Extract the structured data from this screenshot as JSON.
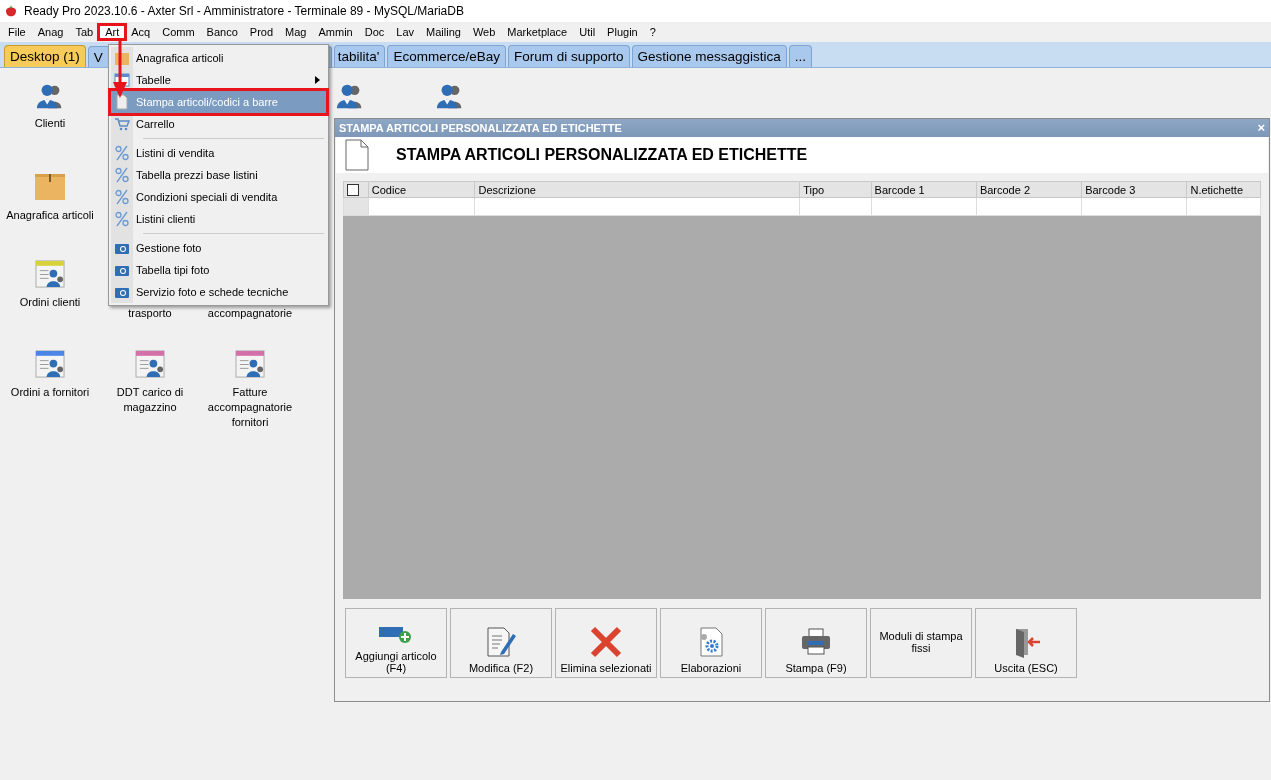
{
  "window": {
    "title": "Ready Pro 2023.10.6 - Axter Srl - Amministratore - Terminale 89 - MySQL/MariaDB"
  },
  "menu_bar": [
    {
      "label": "File",
      "selected": false
    },
    {
      "label": "Anag",
      "selected": false
    },
    {
      "label": "Tab",
      "selected": false
    },
    {
      "label": "Art",
      "selected": true
    },
    {
      "label": "Acq",
      "selected": false
    },
    {
      "label": "Comm",
      "selected": false
    },
    {
      "label": "Banco",
      "selected": false
    },
    {
      "label": "Prod",
      "selected": false
    },
    {
      "label": "Mag",
      "selected": false
    },
    {
      "label": "Ammin",
      "selected": false
    },
    {
      "label": "Doc",
      "selected": false
    },
    {
      "label": "Lav",
      "selected": false
    },
    {
      "label": "Mailing",
      "selected": false
    },
    {
      "label": "Web",
      "selected": false
    },
    {
      "label": "Marketplace",
      "selected": false
    },
    {
      "label": "Util",
      "selected": false
    },
    {
      "label": "Plugin",
      "selected": false
    },
    {
      "label": "?",
      "selected": false
    }
  ],
  "tabs": [
    {
      "label": "Desktop (1)",
      "selected": true
    },
    {
      "label": "V",
      "selected": false
    },
    {
      "label": "tabilita'",
      "selected": false
    },
    {
      "label": "Ecommerce/eBay",
      "selected": false
    },
    {
      "label": "Forum di supporto",
      "selected": false
    },
    {
      "label": "Gestione messaggistica",
      "selected": false
    },
    {
      "label": "...",
      "selected": false
    }
  ],
  "desktop": [
    [
      {
        "kind": "person",
        "label": "Clienti"
      },
      {
        "kind": "covered"
      },
      {
        "kind": "covered"
      },
      {
        "kind": "agent"
      },
      {
        "kind": "agent"
      }
    ],
    [
      {
        "kind": "box",
        "label": "Anagrafica articoli"
      }
    ],
    [
      {
        "kind": "order",
        "color": "#d8d23a",
        "label": "Ordini clienti"
      },
      {
        "kind": "text",
        "label": "trasporto"
      },
      {
        "kind": "text",
        "label": "accompagnatorie"
      }
    ],
    [
      {
        "kind": "order",
        "color": "#4a86e8",
        "label": "Ordini a fornitori"
      },
      {
        "kind": "order",
        "color": "#d46fa8",
        "label": "DDT carico di magazzino"
      },
      {
        "kind": "order",
        "color": "#d46fa8",
        "label": "Fatture accompagnatorie fornitori"
      }
    ]
  ],
  "dropdown": [
    {
      "kind": "box",
      "label": "Anagrafica articoli",
      "selected": false,
      "submenu": false
    },
    {
      "kind": "table",
      "label": "Tabelle",
      "selected": false,
      "submenu": true
    },
    {
      "kind": "page",
      "label": "Stampa articoli/codici a barre",
      "selected": true,
      "submenu": false
    },
    {
      "kind": "cart",
      "label": "Carrello",
      "selected": false,
      "submenu": false
    },
    {
      "kind": "separator"
    },
    {
      "kind": "percent",
      "label": "Listini di vendita",
      "selected": false,
      "submenu": false
    },
    {
      "kind": "percent",
      "label": "Tabella prezzi base listini",
      "selected": false,
      "submenu": false
    },
    {
      "kind": "percent",
      "label": "Condizioni speciali di vendita",
      "selected": false,
      "submenu": false
    },
    {
      "kind": "percent",
      "label": "Listini clienti",
      "selected": false,
      "submenu": false
    },
    {
      "kind": "separator"
    },
    {
      "kind": "camera",
      "label": "Gestione foto",
      "selected": false,
      "submenu": false
    },
    {
      "kind": "camera",
      "label": "Tabella tipi foto",
      "selected": false,
      "submenu": false
    },
    {
      "kind": "camera",
      "label": "Servizio foto e schede tecniche",
      "selected": false,
      "submenu": false
    }
  ],
  "dialog": {
    "title": "STAMPA ARTICOLI PERSONALIZZATA ED ETICHETTE",
    "close": "×",
    "heading": "STAMPA ARTICOLI PERSONALIZZATA ED ETICHETTE",
    "table": {
      "select_all": {
        "checked": false
      },
      "columns": [
        "Codice",
        "Descrizione",
        "Tipo",
        "Barcode 1",
        "Barcode 2",
        "Barcode 3",
        "N.etichette"
      ]
    },
    "buttons": [
      {
        "kind": "add",
        "label": "Aggiungi articolo (F4)"
      },
      {
        "kind": "edit",
        "label": "Modifica (F2)"
      },
      {
        "kind": "delete",
        "label": "Elimina selezionati"
      },
      {
        "kind": "gear",
        "label": "Elaborazioni"
      },
      {
        "kind": "print",
        "label": "Stampa (F9)"
      },
      {
        "kind": "text",
        "label": "Moduli di stampa fissi"
      },
      {
        "kind": "exit",
        "label": "Uscita (ESC)"
      }
    ]
  }
}
